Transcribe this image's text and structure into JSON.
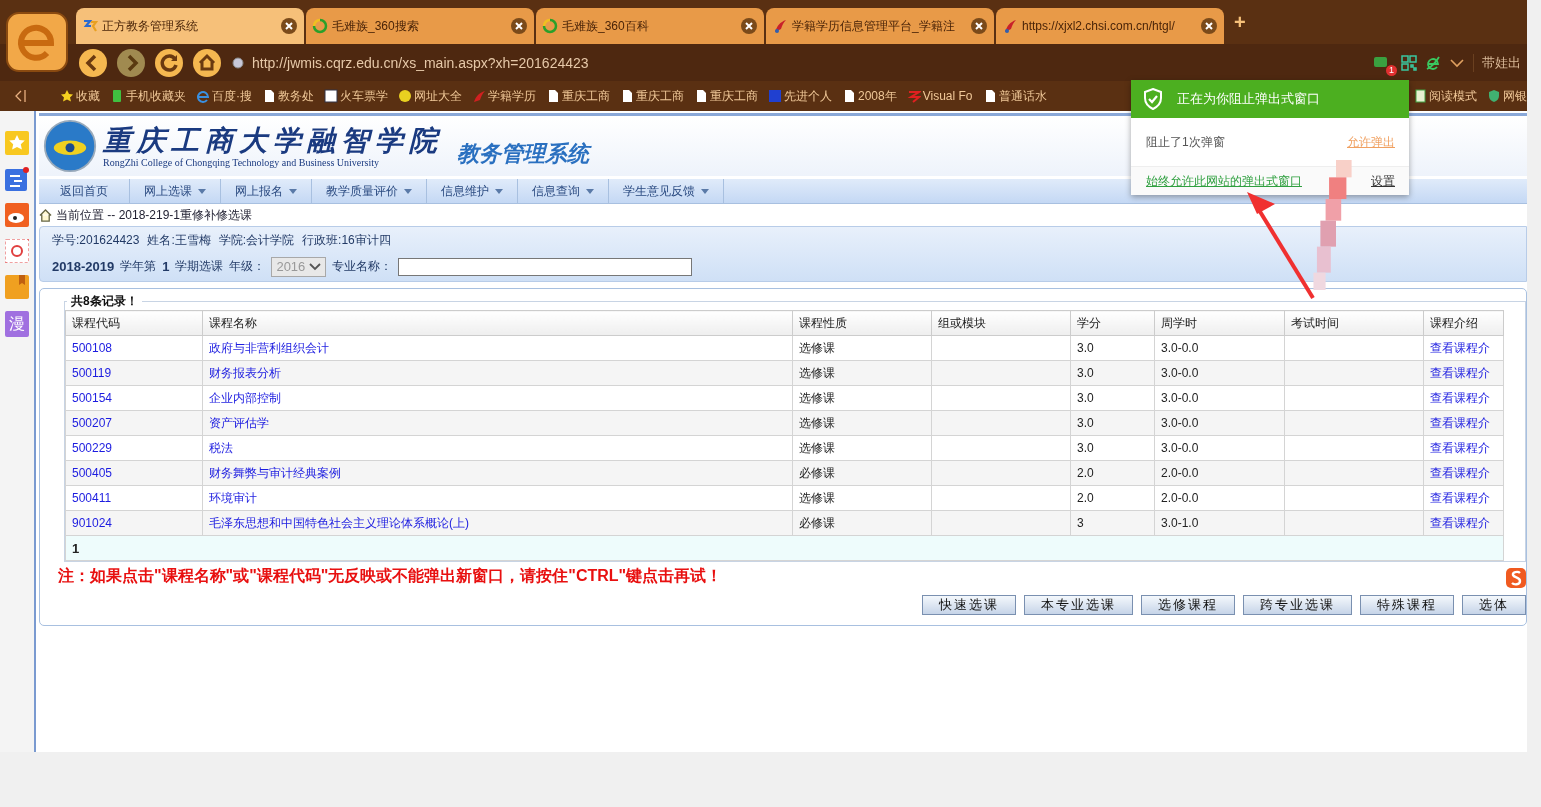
{
  "browser": {
    "tabs": [
      {
        "title": "正方教务管理系统",
        "selected": true
      },
      {
        "title": "毛难族_360搜索",
        "selected": false
      },
      {
        "title": "毛难族_360百科",
        "selected": false
      },
      {
        "title": "学籍学历信息管理平台_学籍注",
        "selected": false
      },
      {
        "title": "https://xjxl2.chsi.com.cn/htgl/",
        "selected": false
      }
    ],
    "new_tab": "+",
    "address": "http://jwmis.cqrz.edu.cn/xs_main.aspx?xh=201624423",
    "popup_badge": "1",
    "toolbar_text": "带娃出",
    "bookmarks": [
      "收藏",
      "手机收藏夹",
      "百度·搜",
      "教务处",
      "火车票学",
      "网址大全",
      "学籍学历",
      "重庆工商",
      "重庆工商",
      "重庆工商",
      "先进个人",
      "2008年",
      "Visual Fo",
      "普通话水"
    ],
    "bookmarks_right": [
      "阅读模式",
      "网银"
    ],
    "sidebar_text": "漫"
  },
  "page": {
    "school_name": "重庆工商大学融智学院",
    "school_english": "RongZhi College of Chongqing Technology and Business University",
    "system_name": "教务管理系统",
    "nav": [
      {
        "label": "返回首页",
        "has_menu": false
      },
      {
        "label": "网上选课",
        "has_menu": true
      },
      {
        "label": "网上报名",
        "has_menu": true
      },
      {
        "label": "教学质量评价",
        "has_menu": true
      },
      {
        "label": "信息维护",
        "has_menu": true
      },
      {
        "label": "信息查询",
        "has_menu": true
      },
      {
        "label": "学生意见反馈",
        "has_menu": true
      }
    ],
    "breadcrumb": "当前位置 -- 2018-219-1重修补修选课",
    "student_info": [
      "学号:201624423",
      "姓名:王雪梅",
      "学院:会计学院",
      "行政班:16审计四"
    ],
    "term": {
      "year": "2018-2019",
      "year_label": "学年第",
      "semester": "1",
      "semester_label": "学期选课",
      "grade_label": "年级：",
      "grade": "2016",
      "grade_disabled": true,
      "major_label": "专业名称："
    },
    "legend": "共8条记录！",
    "table": {
      "columns": [
        "课程代码",
        "课程名称",
        "课程性质",
        "组或模块",
        "学分",
        "周学时",
        "考试时间",
        "课程介绍"
      ],
      "rows": [
        {
          "code": "500108",
          "name": "政府与非营利组织会计",
          "type": "选修课",
          "credit": "3.0",
          "hours": "3.0-0.0",
          "intro": "查看课程介"
        },
        {
          "code": "500119",
          "name": "财务报表分析",
          "type": "选修课",
          "credit": "3.0",
          "hours": "3.0-0.0",
          "intro": "查看课程介"
        },
        {
          "code": "500154",
          "name": "企业内部控制",
          "type": "选修课",
          "credit": "3.0",
          "hours": "3.0-0.0",
          "intro": "查看课程介"
        },
        {
          "code": "500207",
          "name": "资产评估学",
          "type": "选修课",
          "credit": "3.0",
          "hours": "3.0-0.0",
          "intro": "查看课程介"
        },
        {
          "code": "500229",
          "name": "税法",
          "type": "选修课",
          "credit": "3.0",
          "hours": "3.0-0.0",
          "intro": "查看课程介"
        },
        {
          "code": "500405",
          "name": "财务舞弊与审计经典案例",
          "type": "必修课",
          "credit": "2.0",
          "hours": "2.0-0.0",
          "intro": "查看课程介"
        },
        {
          "code": "500411",
          "name": "环境审计",
          "type": "选修课",
          "credit": "2.0",
          "hours": "2.0-0.0",
          "intro": "查看课程介"
        },
        {
          "code": "901024",
          "name": "毛泽东思想和中国特色社会主义理论体系概论(上)",
          "type": "必修课",
          "credit": "3",
          "hours": "3.0-1.0",
          "intro": "查看课程介"
        }
      ],
      "pager": "1"
    },
    "note": "注：如果点击\"课程名称\"或\"课程代码\"无反映或不能弹出新窗口，请按住\"CTRL\"键点击再试！",
    "buttons": [
      "快速选课",
      "本专业选课",
      "选修课程",
      "跨专业选课",
      "特殊课程",
      "选体"
    ]
  },
  "popup": {
    "title": "正在为你阻止弹出式窗口",
    "message": "阻止了1次弹窗",
    "allow": "允许弹出",
    "always_allow": "始终允许此网站的弹出式窗口",
    "settings": "设置"
  }
}
